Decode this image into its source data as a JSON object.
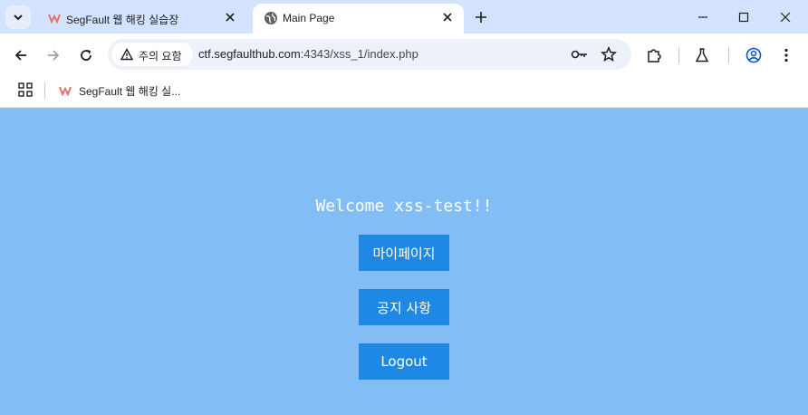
{
  "browser": {
    "tabs": [
      {
        "title": "SegFault 웹 해킹 실습장",
        "favicon": "segfault-logo-icon",
        "active": false
      },
      {
        "title": "Main Page",
        "favicon": "globe-icon",
        "active": true
      }
    ],
    "security_chip": "주의 요함",
    "url": {
      "host": "ctf.segfaulthub.com",
      "rest": ":4343/xss_1/index.php"
    },
    "bookmarks": [
      {
        "title": "SegFault 웹 해킹 실...",
        "favicon": "segfault-logo-icon"
      }
    ],
    "colors": {
      "tabstrip": "#d3e3fd",
      "omnibox": "#edf2fa",
      "profile_accent": "#0b57d0"
    }
  },
  "page": {
    "welcome": "Welcome xss-test!!",
    "buttons": {
      "mypage": "마이페이지",
      "notice": "공지 사항",
      "logout": "Logout"
    },
    "colors": {
      "background": "#83bdf5",
      "button": "#1e88e5",
      "text": "#ffffff"
    }
  }
}
